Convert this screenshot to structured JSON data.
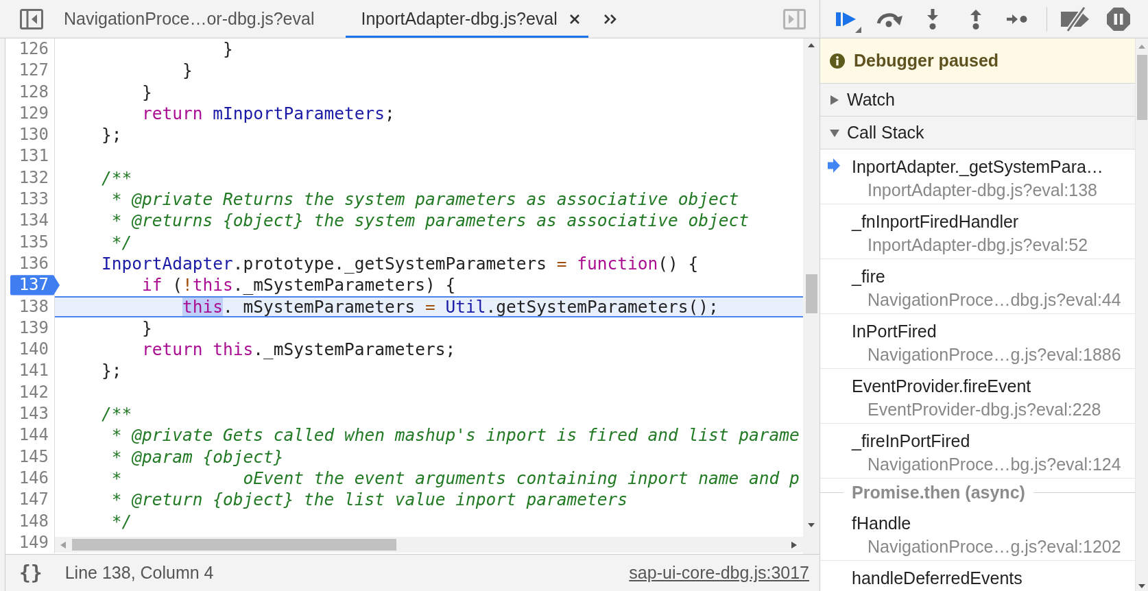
{
  "editor_tabs": [
    {
      "label": "NavigationProce…or-dbg.js?eval",
      "selected": false
    },
    {
      "label": "InportAdapter-dbg.js?eval",
      "selected": true
    }
  ],
  "code": {
    "lines": [
      {
        "number": "126",
        "breakpoint": false,
        "current": false,
        "tokens": [
          {
            "kind": "plain",
            "text": "                }",
            "highlighted": false
          }
        ]
      },
      {
        "number": "127",
        "breakpoint": false,
        "current": false,
        "tokens": [
          {
            "kind": "plain",
            "text": "            }",
            "highlighted": false
          }
        ]
      },
      {
        "number": "128",
        "breakpoint": false,
        "current": false,
        "tokens": [
          {
            "kind": "plain",
            "text": "        }",
            "highlighted": false
          }
        ]
      },
      {
        "number": "129",
        "breakpoint": false,
        "current": false,
        "tokens": [
          {
            "kind": "keyword",
            "text": "        return",
            "highlighted": false
          },
          {
            "kind": "variable",
            "text": " mInportParameters",
            "highlighted": false
          },
          {
            "kind": "plain",
            "text": ";",
            "highlighted": false
          }
        ]
      },
      {
        "number": "130",
        "breakpoint": false,
        "current": false,
        "tokens": [
          {
            "kind": "plain",
            "text": "    };",
            "highlighted": false
          }
        ]
      },
      {
        "number": "131",
        "breakpoint": false,
        "current": false
      },
      {
        "number": "132",
        "breakpoint": false,
        "current": false,
        "tokens": [
          {
            "kind": "comment",
            "text": "    /**",
            "highlighted": false
          }
        ]
      },
      {
        "number": "133",
        "breakpoint": false,
        "current": false,
        "tokens": [
          {
            "kind": "comment",
            "text": "     * @private Returns the system parameters as associative object",
            "highlighted": false
          }
        ]
      },
      {
        "number": "134",
        "breakpoint": false,
        "current": false,
        "tokens": [
          {
            "kind": "comment",
            "text": "     * @returns {object} the system parameters as associative object",
            "highlighted": false
          }
        ]
      },
      {
        "number": "135",
        "breakpoint": false,
        "current": false,
        "tokens": [
          {
            "kind": "comment",
            "text": "     */",
            "highlighted": false
          }
        ]
      },
      {
        "number": "136",
        "breakpoint": false,
        "current": false,
        "tokens": [
          {
            "kind": "variable",
            "text": "    InportAdapter",
            "highlighted": false
          },
          {
            "kind": "plain",
            "text": ".prototype._getSystemParameters ",
            "highlighted": false
          },
          {
            "kind": "operator",
            "text": "=",
            "highlighted": false
          },
          {
            "kind": "keyword",
            "text": " function",
            "highlighted": false
          },
          {
            "kind": "plain",
            "text": "() {",
            "highlighted": false
          }
        ]
      },
      {
        "number": "137",
        "breakpoint": true,
        "current": false,
        "tokens": [
          {
            "kind": "keyword",
            "text": "        if",
            "highlighted": false
          },
          {
            "kind": "plain",
            "text": " (",
            "highlighted": false
          },
          {
            "kind": "operator",
            "text": "!",
            "highlighted": false
          },
          {
            "kind": "keyword",
            "text": "this",
            "highlighted": false
          },
          {
            "kind": "plain",
            "text": "._mSystemParameters) {",
            "highlighted": false
          }
        ]
      },
      {
        "number": "138",
        "breakpoint": false,
        "current": true,
        "tokens": [
          {
            "kind": "keyword",
            "text": "            this",
            "highlighted": true
          },
          {
            "kind": "plain",
            "text": "._mSystemParameters ",
            "highlighted": false
          },
          {
            "kind": "operator",
            "text": "=",
            "highlighted": false
          },
          {
            "kind": "variable",
            "text": " Util",
            "highlighted": false
          },
          {
            "kind": "plain",
            "text": ".getSystemParameters();",
            "highlighted": false
          }
        ]
      },
      {
        "number": "139",
        "breakpoint": false,
        "current": false,
        "tokens": [
          {
            "kind": "plain",
            "text": "        }",
            "highlighted": false
          }
        ]
      },
      {
        "number": "140",
        "breakpoint": false,
        "current": false,
        "tokens": [
          {
            "kind": "keyword",
            "text": "        return this",
            "highlighted": false
          },
          {
            "kind": "plain",
            "text": "._mSystemParameters;",
            "highlighted": false
          }
        ]
      },
      {
        "number": "141",
        "breakpoint": false,
        "current": false,
        "tokens": [
          {
            "kind": "plain",
            "text": "    };",
            "highlighted": false
          }
        ]
      },
      {
        "number": "142",
        "breakpoint": false,
        "current": false
      },
      {
        "number": "143",
        "breakpoint": false,
        "current": false,
        "tokens": [
          {
            "kind": "comment",
            "text": "    /**",
            "highlighted": false
          }
        ]
      },
      {
        "number": "144",
        "breakpoint": false,
        "current": false,
        "tokens": [
          {
            "kind": "comment",
            "text": "     * @private Gets called when mashup's inport is fired and list parame",
            "highlighted": false
          }
        ]
      },
      {
        "number": "145",
        "breakpoint": false,
        "current": false,
        "tokens": [
          {
            "kind": "comment",
            "text": "     * @param {object}",
            "highlighted": false
          }
        ]
      },
      {
        "number": "146",
        "breakpoint": false,
        "current": false,
        "tokens": [
          {
            "kind": "comment",
            "text": "     *            oEvent the event arguments containing inport name and p",
            "highlighted": false
          }
        ]
      },
      {
        "number": "147",
        "breakpoint": false,
        "current": false,
        "tokens": [
          {
            "kind": "comment",
            "text": "     * @return {object} the list value inport parameters",
            "highlighted": false
          }
        ]
      },
      {
        "number": "148",
        "breakpoint": false,
        "current": false,
        "tokens": [
          {
            "kind": "comment",
            "text": "     */",
            "highlighted": false
          }
        ]
      },
      {
        "number": "149",
        "breakpoint": false,
        "current": false
      }
    ]
  },
  "status_bar": {
    "format_button": "{}",
    "position": "Line 138, Column 4",
    "source_link": "sap-ui-core-dbg.js:3017"
  },
  "debugger": {
    "banner": "Debugger paused",
    "sections": [
      {
        "title": "Watch",
        "expanded": false
      },
      {
        "title": "Call Stack",
        "expanded": true,
        "frames": [
          {
            "kind": "frame",
            "function": "InportAdapter._getSystemPara…",
            "location": "InportAdapter-dbg.js?eval:138",
            "selected": true
          },
          {
            "kind": "frame",
            "function": "_fnInportFiredHandler",
            "location": "InportAdapter-dbg.js?eval:52",
            "selected": false
          },
          {
            "kind": "frame",
            "function": "_fire",
            "location": "NavigationProce…dbg.js?eval:44",
            "selected": false
          },
          {
            "kind": "frame",
            "function": "InPortFired",
            "location": "NavigationProce…g.js?eval:1886",
            "selected": false
          },
          {
            "kind": "frame",
            "function": "EventProvider.fireEvent",
            "location": "EventProvider-dbg.js?eval:228",
            "selected": false
          },
          {
            "kind": "frame",
            "function": "_fireInPortFired",
            "location": "NavigationProce…bg.js?eval:124",
            "selected": false
          },
          {
            "kind": "async",
            "label": "Promise.then (async)"
          },
          {
            "kind": "frame",
            "function": "fHandle",
            "location": "NavigationProce…g.js?eval:1202",
            "selected": false
          },
          {
            "kind": "frame",
            "function": "handleDeferredEvents",
            "selected": false
          }
        ]
      }
    ]
  }
}
